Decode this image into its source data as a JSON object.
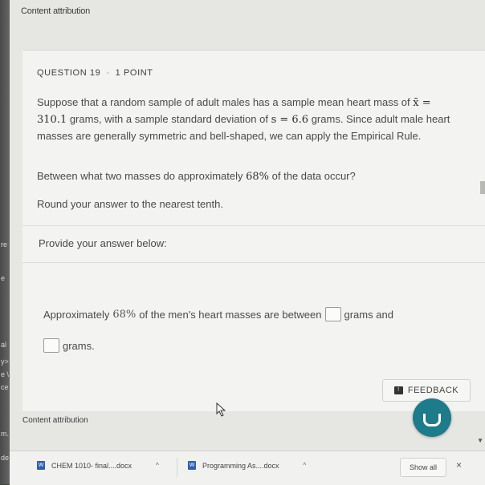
{
  "attribution": {
    "top": "Content attribution",
    "bottom": "Content attribution"
  },
  "question": {
    "number_label": "QUESTION 19",
    "separator": "·",
    "points_label": "1 POINT",
    "text_part1": "Suppose that a random sample of adult males has a sample mean heart mass of",
    "xbar_expr": "x̄ = 310.1",
    "text_part2": " grams, with a sample standard deviation of ",
    "s_expr": "s = 6.6",
    "text_part3": " grams. Since adult male heart masses are generally symmetric and bell-shaped, we can apply the Empirical Rule.",
    "between_prefix": "Between what two masses do approximately ",
    "percent_expr": "68%",
    "between_suffix": " of the data occur?",
    "round_text": "Round your answer to the nearest tenth."
  },
  "answer": {
    "provide_label": "Provide your answer below:",
    "line1_prefix": "Approximately ",
    "line1_percent": "68%",
    "line1_middle": " of the men's heart masses are between",
    "line1_suffix": "grams and",
    "line2_suffix": "grams.",
    "lower_value": "",
    "upper_value": ""
  },
  "feedback": {
    "label": "FEEDBACK"
  },
  "downloads": {
    "items": [
      {
        "name": "CHEM 1010- final....docx"
      },
      {
        "name": "Programming As....docx"
      }
    ],
    "show_all": "Show all",
    "close": "×"
  },
  "leftstrip": {
    "fragments": [
      "re",
      "e",
      "al",
      "y>",
      "e \\",
      "ce",
      "m.",
      "de"
    ]
  },
  "colors": {
    "accent": "#1e7b8a",
    "download_icon": "#2f5db0"
  }
}
